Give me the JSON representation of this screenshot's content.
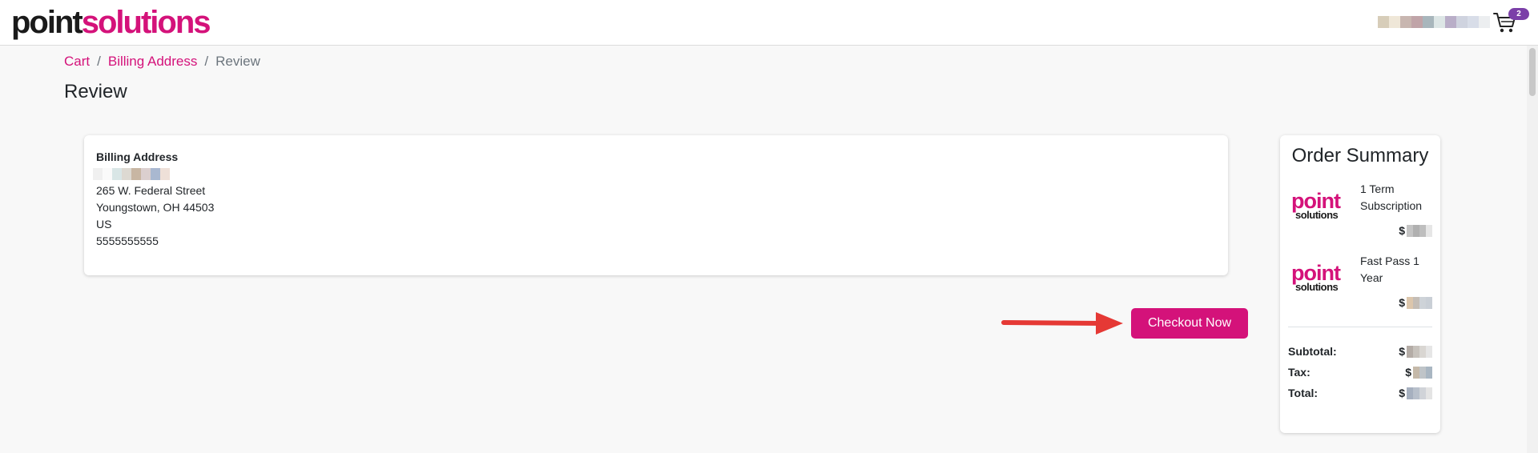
{
  "header": {
    "logo_part1": "point",
    "logo_part2": "solutions",
    "cart_count": "2",
    "user_blur_colors": [
      "#d7cdb9",
      "#efe7d8",
      "#c8b6b0",
      "#c0a4a8",
      "#a8b6bc",
      "#dde6e6",
      "#b9aec8",
      "#cfd3df",
      "#d8dde8",
      "#eceef0"
    ]
  },
  "breadcrumb": {
    "cart": "Cart",
    "billing": "Billing Address",
    "current": "Review",
    "separator": "/"
  },
  "page_title": "Review",
  "billing": {
    "heading": "Billing Address",
    "name_blur_colors": [
      "#f0f0f0",
      "#fafafa",
      "#d9e6e6",
      "#ddd9d2",
      "#c8b6a3",
      "#dbcfcf",
      "#a9b8d0",
      "#eee0d8"
    ],
    "street": "265 W. Federal Street",
    "city_line": "Youngstown, OH 44503",
    "country": "US",
    "phone": "5555555555"
  },
  "checkout_button": "Checkout Now",
  "summary": {
    "title": "Order Summary",
    "items": [
      {
        "logo_part1": "point",
        "logo_part2": "solutions",
        "name": "1 Term Subscription",
        "currency": "$",
        "price_blur_colors": [
          "#c4c4c4",
          "#b0b0b0",
          "#bebebe",
          "#e6e6e6"
        ]
      },
      {
        "logo_part1": "point",
        "logo_part2": "solutions",
        "name": "Fast Pass 1 Year",
        "currency": "$",
        "price_blur_colors": [
          "#dcc6ac",
          "#c4bdb6",
          "#ced3d8",
          "#c9cfd6"
        ]
      }
    ],
    "subtotal_label": "Subtotal:",
    "tax_label": "Tax:",
    "total_label": "Total:",
    "currency": "$",
    "subtotal_blur_colors": [
      "#b4aca6",
      "#c7c2bc",
      "#d9d6d2",
      "#e6e6e6"
    ],
    "tax_blur_colors": [
      "#c5b9a9",
      "#bfc4c8",
      "#a9b6c2"
    ],
    "total_blur_colors": [
      "#a6b0bf",
      "#b8c0cb",
      "#d0d3d8",
      "#e4e4e4"
    ]
  },
  "colors": {
    "brand": "#d4127a",
    "badge": "#7b3fa8",
    "arrow": "#e53935"
  }
}
